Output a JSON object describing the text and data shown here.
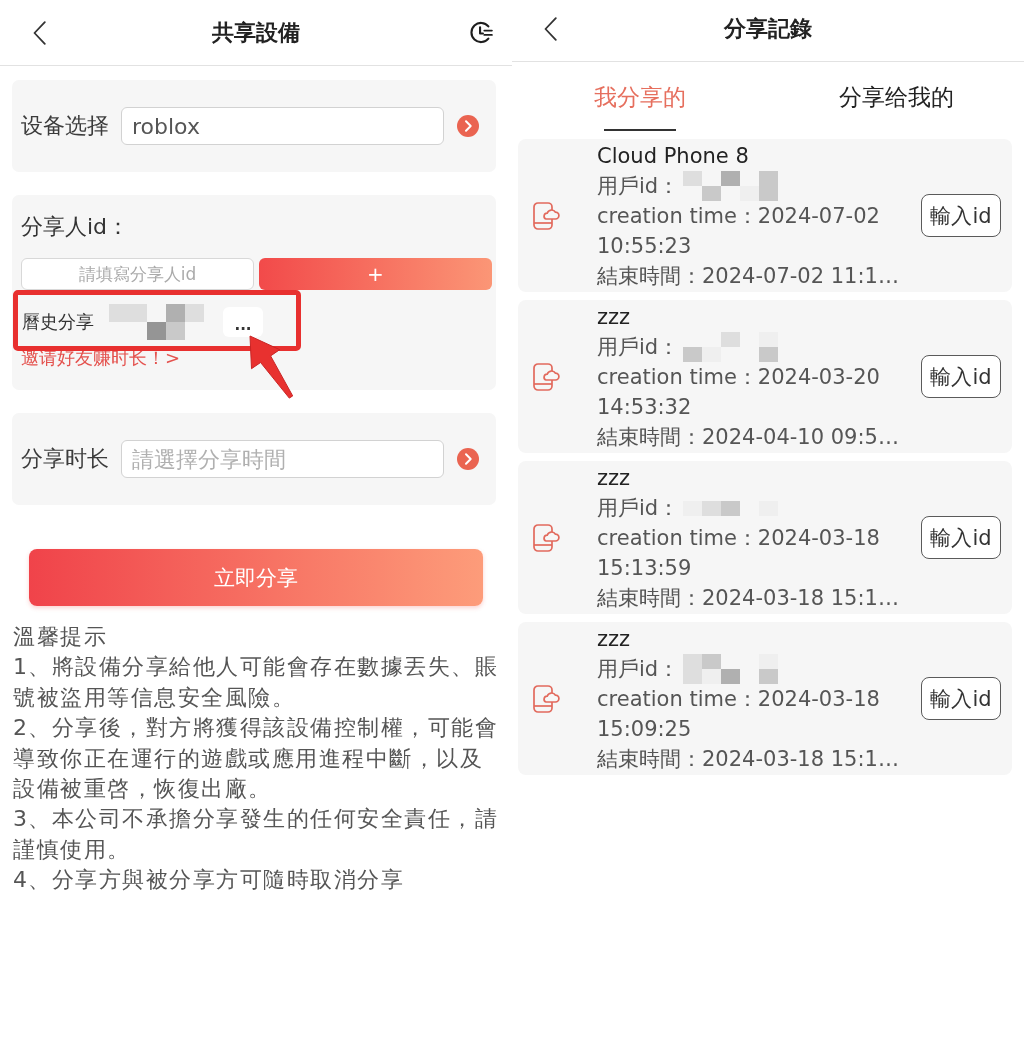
{
  "share_device": {
    "header": {
      "title": "共享設備"
    },
    "device": {
      "label": "设备选择",
      "value": "roblox"
    },
    "sharer": {
      "label": "分享人id：",
      "placeholder": "請填寫分享人id",
      "add_button": "+",
      "history_label": "曆史分享",
      "history_redacted": true,
      "more_button": "...",
      "invite_link": "邀请好友赚时长！>"
    },
    "duration": {
      "label": "分享时长",
      "placeholder": "請選擇分享時間"
    },
    "share_button": "立即分享",
    "tips": {
      "title": "溫馨提示",
      "items": [
        "1、將設備分享給他人可能會存在數據丟失、賬號被盜用等信息安全風險。",
        "2、分享後，對方將獲得該設備控制權，可能會導致你正在運行的遊戲或應用進程中斷，以及設備被重啓，恢復出廠。",
        "3、本公司不承擔分享發生的任何安全責任，請謹慎使用。",
        "4、分享方與被分享方可隨時取消分享"
      ]
    },
    "annotations": [
      {
        "kind": "frame"
      },
      {
        "kind": "arrow"
      }
    ]
  },
  "share_records": {
    "header": {
      "title": "分享記錄"
    },
    "tabs": [
      {
        "label": "我分享的",
        "selected": true
      },
      {
        "label": "分享给我的",
        "selected": false
      }
    ],
    "records": [
      {
        "name": "Cloud Phone 8",
        "user_id_label": "用戶id：",
        "user_id_redacted": true,
        "creation_time": "creation time：2024-07-02 10:55:23",
        "end_time": "結束時間：2024-07-02 11:1…",
        "button": "輸入id"
      },
      {
        "name": "zzz",
        "user_id_label": "用戶id：",
        "user_id_redacted": true,
        "creation_time": "creation time：2024-03-20 14:53:32",
        "end_time": "結束時間：2024-04-10 09:5…",
        "button": "輸入id"
      },
      {
        "name": "zzz",
        "user_id_label": "用戶id：",
        "user_id_redacted": true,
        "creation_time": "creation time：2024-03-18 15:13:59",
        "end_time": "結束時間：2024-03-18 15:1…",
        "button": "輸入id"
      },
      {
        "name": "zzz",
        "user_id_label": "用戶id：",
        "user_id_redacted": true,
        "creation_time": "creation time：2024-03-18 15:09:25",
        "end_time": "結束時間：2024-03-18 15:1…",
        "button": "輸入id"
      }
    ]
  }
}
